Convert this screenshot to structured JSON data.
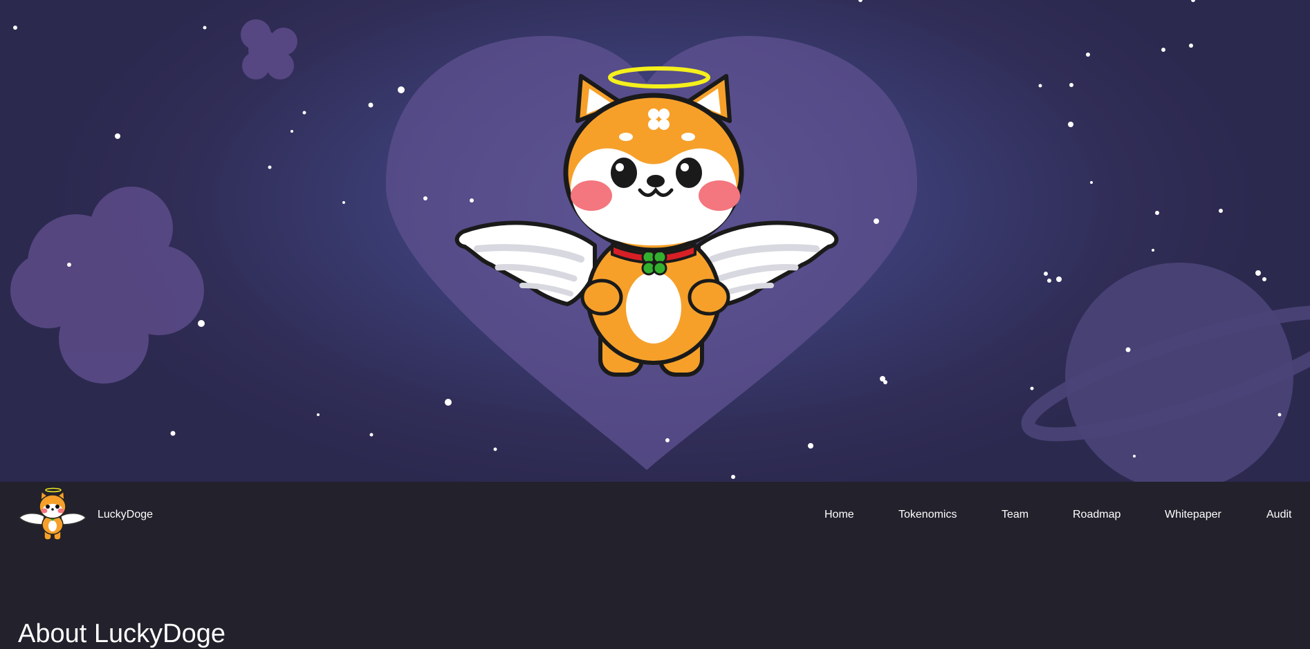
{
  "hero": {
    "mascot_icon": "angel-shiba-inu-with-halo-wings-and-clover-collar",
    "background_icons": [
      "heart-glow",
      "four-leaf-clover",
      "ringed-planet",
      "stars"
    ],
    "colors": {
      "sky": "#302d57",
      "glow": "#43528f",
      "heart": "#5a4f8c",
      "clover": "#5a4a86",
      "planet": "#4a4478",
      "fur": "#f6a02a",
      "halo": "#f5f01c",
      "collar": "#d81f26",
      "clover_charm": "#33b02e"
    }
  },
  "navbar": {
    "brand_name": "LuckyDoge",
    "logo_icon": "angel-shiba-logo",
    "links": [
      "Home",
      "Tokenomics",
      "Team",
      "Roadmap",
      "Whitepaper",
      "Audit"
    ],
    "colors": {
      "background": "#22212c",
      "text": "#ffffff"
    }
  },
  "about": {
    "title": "About LuckyDoge"
  }
}
